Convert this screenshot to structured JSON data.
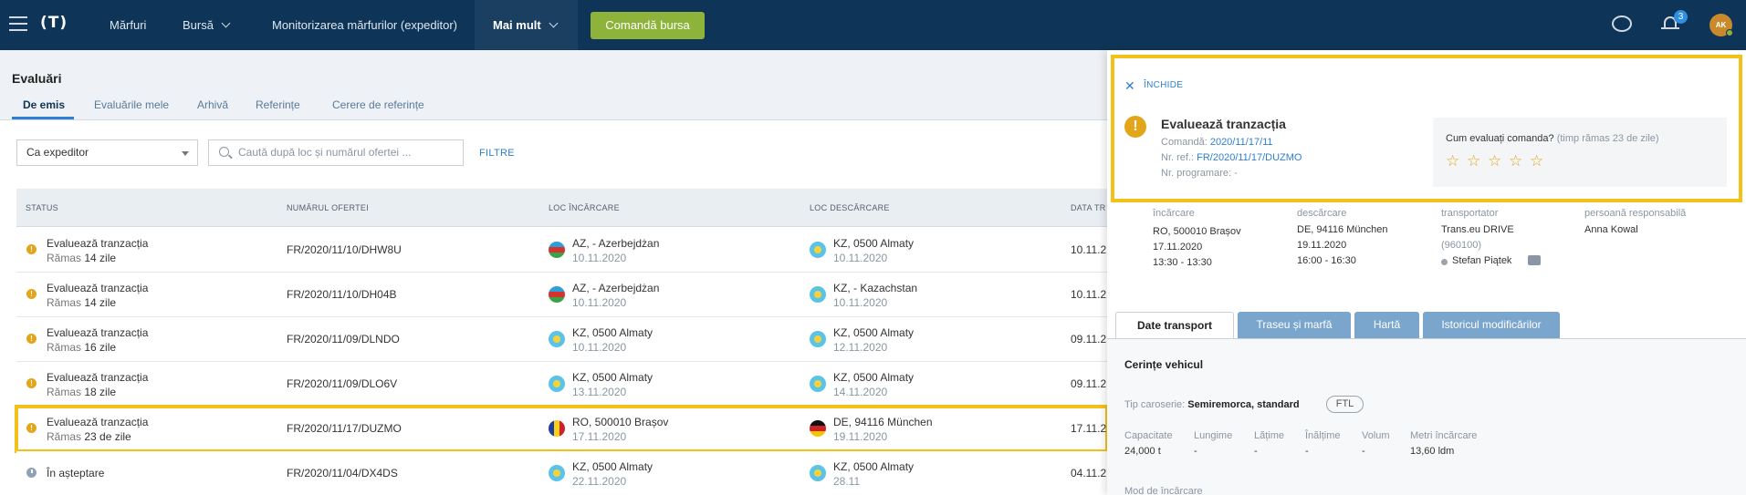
{
  "topbar": {
    "logo": "(T)",
    "nav": [
      "Mărfuri",
      "Bursă",
      "Monitorizarea mărfurilor (expeditor)",
      "Mai mult"
    ],
    "order_button": "Comandă bursa",
    "notifications_count": "3",
    "avatar_initials": "AK"
  },
  "page": {
    "title": "Evaluări",
    "tabs": [
      "De emis",
      "Evaluările mele",
      "Arhivă",
      "Referințe",
      "Cerere de referințe"
    ]
  },
  "filters": {
    "select_value": "Ca expeditor",
    "search_placeholder": "Caută după loc și numărul ofertei ...",
    "filters_label": "FILTRE"
  },
  "table": {
    "headers": [
      "STATUS",
      "NUMĂRUL OFERTEI",
      "LOC ÎNCĂRCARE",
      "LOC DESCĂRCARE",
      "DATA TR"
    ],
    "rows": [
      {
        "status": "Evaluează tranzacția",
        "rem_label": "Rămas",
        "rem": "14 zile",
        "offer": "FR/2020/11/10/DHW8U",
        "load": "AZ, - Azerbejdżan",
        "load_date": "10.11.2020",
        "unload": "KZ, 0500 Almaty",
        "unload_date": "10.11.2020",
        "date": "10.11.2"
      },
      {
        "status": "Evaluează tranzacția",
        "rem_label": "Rămas",
        "rem": "14 zile",
        "offer": "FR/2020/11/10/DH04B",
        "load": "AZ, - Azerbejdżan",
        "load_date": "10.11.2020",
        "unload": "KZ, - Kazachstan",
        "unload_date": "10.11.2020",
        "date": "10.11.2"
      },
      {
        "status": "Evaluează tranzacția",
        "rem_label": "Rămas",
        "rem": "16 zile",
        "offer": "FR/2020/11/09/DLNDO",
        "load": "KZ, 0500 Almaty",
        "load_date": "10.11.2020",
        "unload": "KZ, 0500 Almaty",
        "unload_date": "12.11.2020",
        "date": "09.11.2"
      },
      {
        "status": "Evaluează tranzacția",
        "rem_label": "Rămas",
        "rem": "18 zile",
        "offer": "FR/2020/11/09/DLO6V",
        "load": "KZ, 0500 Almaty",
        "load_date": "13.11.2020",
        "unload": "KZ, 0500 Almaty",
        "unload_date": "14.11.2020",
        "date": "09.11.2"
      },
      {
        "status": "Evaluează tranzacția",
        "rem_label": "Rămas",
        "rem": "23 de zile",
        "offer": "FR/2020/11/17/DUZMO",
        "load": "RO, 500010 Brașov",
        "load_date": "17.11.2020",
        "unload": "DE, 94116 München",
        "unload_date": "19.11.2020",
        "date": "17.11.2"
      },
      {
        "status": "În așteptare",
        "rem_label": "",
        "rem": "",
        "offer": "FR/2020/11/04/DX4DS",
        "load": "KZ, 0500 Almaty",
        "load_date": "22.11.2020",
        "unload": "KZ, 0500 Almaty",
        "unload_date": "28.11",
        "date": "04.11.2"
      }
    ]
  },
  "panel": {
    "close_label": "ÎNCHIDE",
    "title": "Evaluează tranzacția",
    "order_label": "Comandă:",
    "order_value": "2020/11/17/11",
    "ref_label": "Nr. ref.:",
    "ref_value": "FR/2020/11/17/DUZMO",
    "prog_label": "Nr. programare:",
    "prog_value": "-",
    "rate_question": "Cum evaluați comanda?",
    "rate_remaining": "(timp rămas 23 de zile)",
    "stars": "☆",
    "info": {
      "load_label": "încărcare",
      "load_place": "RO, 500010 Brașov",
      "load_date": "17.11.2020",
      "load_time": "13:30 - 13:30",
      "unload_label": "descărcare",
      "unload_place": "DE, 94116 München",
      "unload_date": "19.11.2020",
      "unload_time": "16:00 - 16:30",
      "carrier_label": "transportator",
      "carrier_name": "Trans.eu DRIVE",
      "carrier_id": "(960100)",
      "carrier_person": "Stefan Piątek",
      "resp_label": "persoană responsabilă",
      "resp_name": "Anna Kowal"
    },
    "tabs": [
      "Date transport",
      "Traseu și marfă",
      "Hartă",
      "Istoricul modificărilor"
    ],
    "section_title": "Cerințe vehicul",
    "body_type_label": "Tip caroserie:",
    "body_type_value": "Semiremorca, standard",
    "ftl": "FTL",
    "cap_labels": [
      "Capacitate",
      "Lungime",
      "Lățime",
      "Înălțime",
      "Volum",
      "Metri încărcare"
    ],
    "cap_values": [
      "24,000 t",
      "-",
      "-",
      "-",
      "-",
      "13,60 ldm"
    ],
    "bottom_label": "Mod de încărcare"
  }
}
